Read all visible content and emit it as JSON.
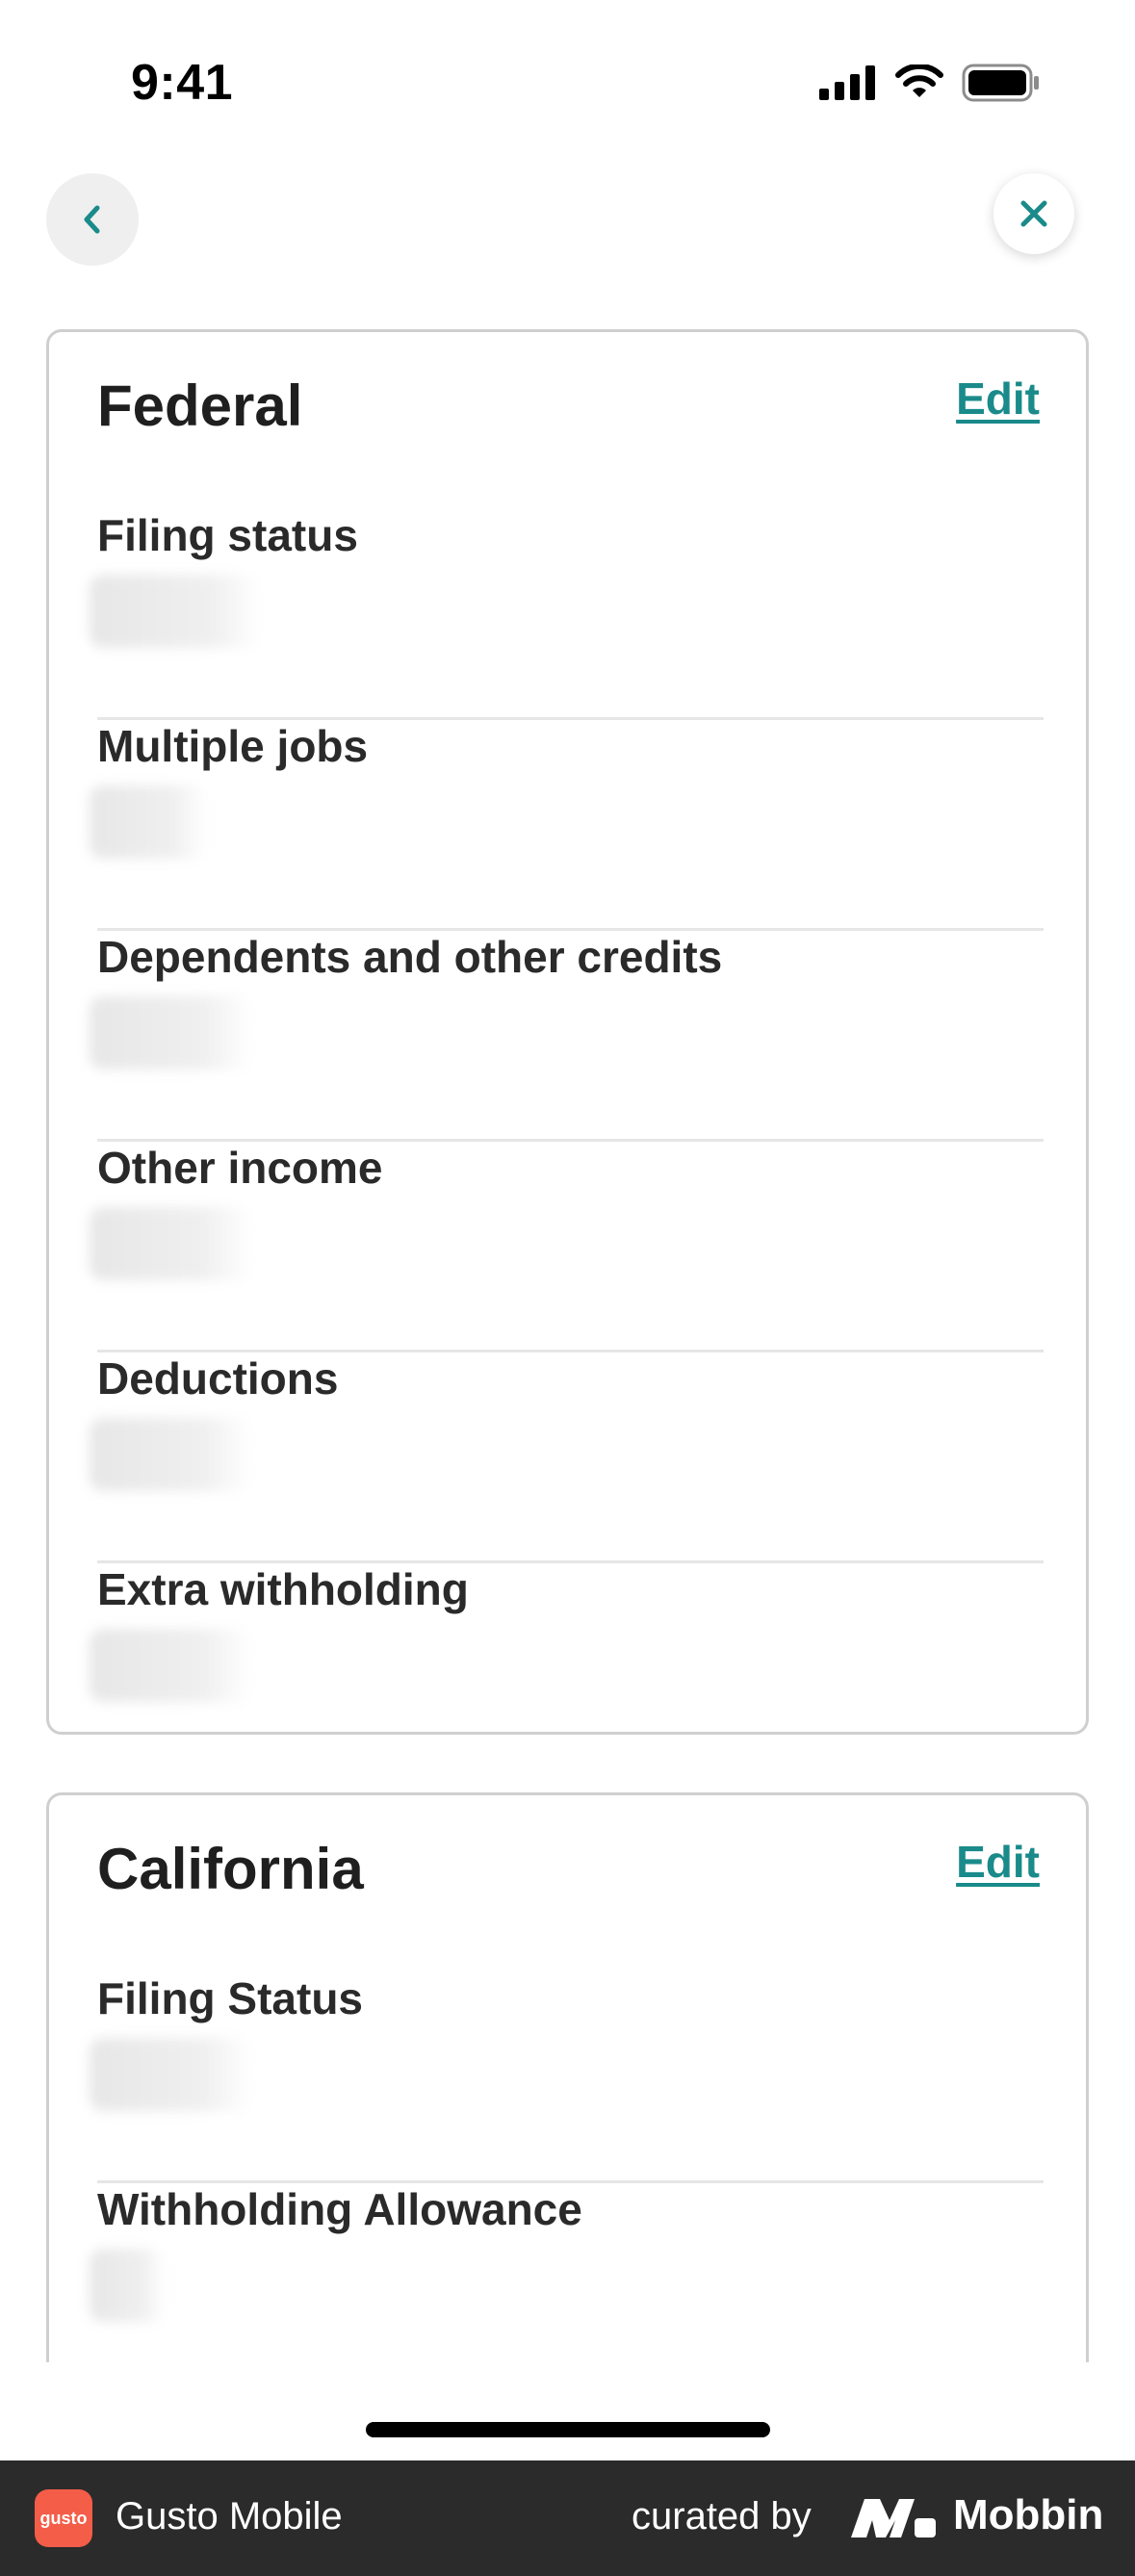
{
  "status_bar": {
    "time": "9:41",
    "icons": [
      "cellular-signal-icon",
      "wifi-icon",
      "battery-icon"
    ]
  },
  "nav": {
    "back_icon": "chevron-left-icon",
    "close_icon": "close-icon",
    "accent_color": "#1a8a8a"
  },
  "federal": {
    "title": "Federal",
    "edit_label": "Edit",
    "fields": [
      {
        "label": "Filing status"
      },
      {
        "label": "Multiple jobs"
      },
      {
        "label": "Dependents and other credits"
      },
      {
        "label": "Other income"
      },
      {
        "label": "Deductions"
      },
      {
        "label": "Extra withholding"
      }
    ]
  },
  "state": {
    "title": "California",
    "edit_label": "Edit",
    "fields": [
      {
        "label": "Filing Status"
      },
      {
        "label": "Withholding Allowance"
      }
    ]
  },
  "footer": {
    "app_logo_text": "gusto",
    "app_name": "Gusto Mobile",
    "curated_by": "curated by",
    "brand": "Mobbin",
    "logo_color": "#f45d48"
  }
}
